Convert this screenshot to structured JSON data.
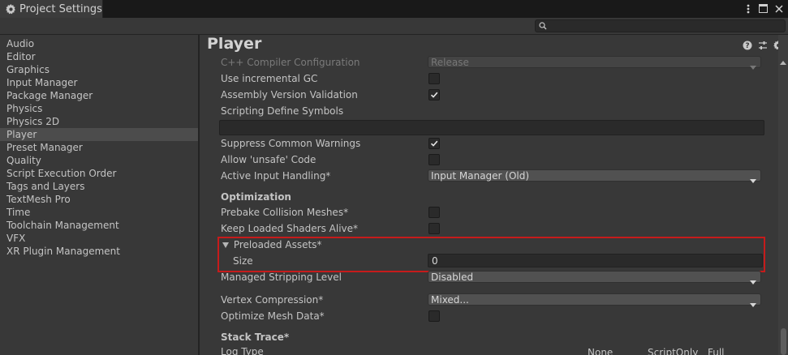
{
  "window": {
    "tab_title": "Project Settings",
    "search_placeholder": ""
  },
  "sidebar": {
    "items": [
      {
        "label": "Audio"
      },
      {
        "label": "Editor"
      },
      {
        "label": "Graphics"
      },
      {
        "label": "Input Manager"
      },
      {
        "label": "Package Manager"
      },
      {
        "label": "Physics"
      },
      {
        "label": "Physics 2D"
      },
      {
        "label": "Player",
        "selected": true
      },
      {
        "label": "Preset Manager"
      },
      {
        "label": "Quality"
      },
      {
        "label": "Script Execution Order"
      },
      {
        "label": "Tags and Layers"
      },
      {
        "label": "TextMesh Pro"
      },
      {
        "label": "Time"
      },
      {
        "label": "Toolchain Management"
      },
      {
        "label": "VFX"
      },
      {
        "label": "XR Plugin Management"
      }
    ]
  },
  "main": {
    "title": "Player",
    "cpp_compiler_label": "C++ Compiler Configuration",
    "cpp_compiler_value": "Release",
    "incremental_gc_label": "Use incremental GC",
    "incremental_gc_checked": false,
    "assembly_validation_label": "Assembly Version Validation",
    "assembly_validation_checked": true,
    "scripting_define_label": "Scripting Define Symbols",
    "scripting_define_value": "",
    "suppress_warnings_label": "Suppress Common Warnings",
    "suppress_warnings_checked": true,
    "allow_unsafe_label": "Allow 'unsafe' Code",
    "allow_unsafe_checked": false,
    "active_input_label": "Active Input Handling*",
    "active_input_value": "Input Manager (Old)",
    "optimization_header": "Optimization",
    "prebake_label": "Prebake Collision Meshes*",
    "prebake_checked": false,
    "keep_shaders_label": "Keep Loaded Shaders Alive*",
    "keep_shaders_checked": false,
    "preloaded_assets_label": "Preloaded Assets*",
    "size_label": "Size",
    "size_value": "0",
    "stripping_label": "Managed Stripping Level",
    "stripping_value": "Disabled",
    "vertex_compression_label": "Vertex Compression*",
    "vertex_compression_value": "Mixed...",
    "optimize_mesh_label": "Optimize Mesh Data*",
    "optimize_mesh_checked": false,
    "stack_trace_header": "Stack Trace*",
    "log_type_label": "Log Type",
    "log_columns": [
      "None",
      "ScriptOnly",
      "Full"
    ]
  },
  "colors": {
    "highlight": "#c61b1b",
    "background": "#383838"
  }
}
